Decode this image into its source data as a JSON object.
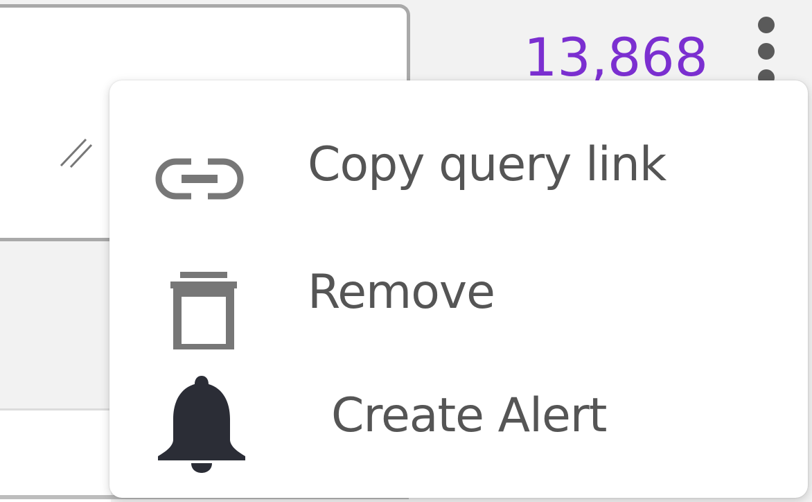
{
  "result": {
    "count": "13,868"
  },
  "menu": {
    "items": [
      {
        "label": "Copy query link",
        "icon": "link-icon"
      },
      {
        "label": "Remove",
        "icon": "trash-icon"
      },
      {
        "label": "Create Alert",
        "icon": "bell-icon"
      }
    ]
  },
  "colors": {
    "count": "#7b2fd0",
    "icon_gray": "#777777",
    "bell": "#2b2d36"
  }
}
